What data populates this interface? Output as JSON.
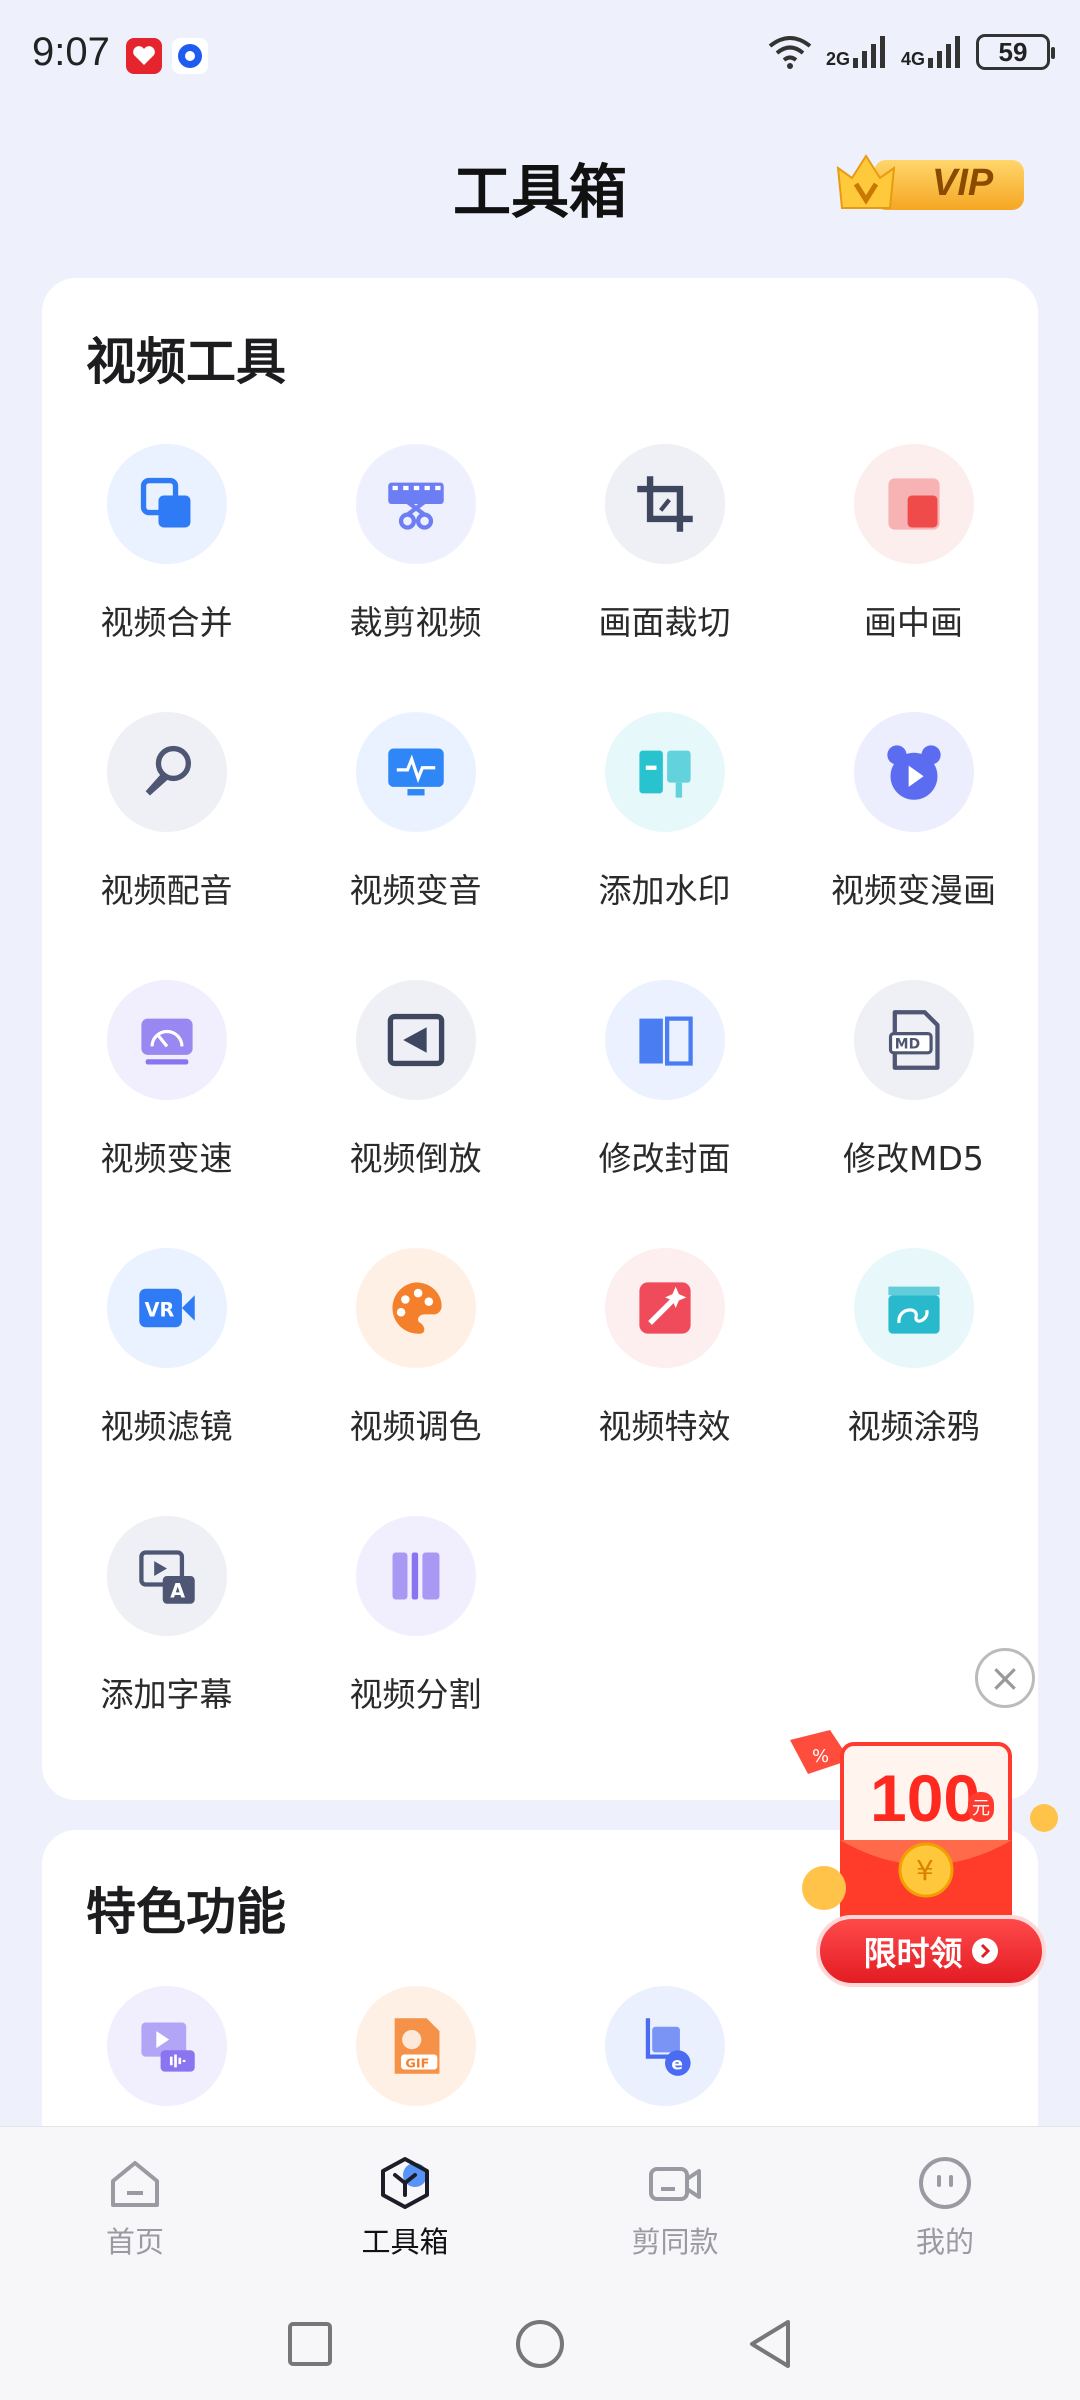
{
  "status_bar": {
    "time": "9:07",
    "network_1": "2G",
    "network_2": "4G",
    "battery": "59"
  },
  "header": {
    "title": "工具箱",
    "vip_label": "VIP"
  },
  "video_tools": {
    "title": "视频工具",
    "items": [
      {
        "label": "视频合并",
        "icon": "merge-icon",
        "color": "#2f7bf6",
        "bg": "#eaf2ff"
      },
      {
        "label": "裁剪视频",
        "icon": "film-scissors-icon",
        "color": "#6d7ef5",
        "bg": "#eef0fe"
      },
      {
        "label": "画面裁切",
        "icon": "crop-icon",
        "color": "#3f4660",
        "bg": "#eef0f5"
      },
      {
        "label": "画中画",
        "icon": "picture-in-picture-icon",
        "color": "#ef4b4b",
        "bg": "#fdeeee"
      },
      {
        "label": "视频配音",
        "icon": "microphone-icon",
        "color": "#4e5673",
        "bg": "#eef0f5"
      },
      {
        "label": "视频变音",
        "icon": "monitor-waveform-icon",
        "color": "#2f86f6",
        "bg": "#eaf2ff"
      },
      {
        "label": "添加水印",
        "icon": "stamp-icon",
        "color": "#29c2cf",
        "bg": "#e7f8fa"
      },
      {
        "label": "视频变漫画",
        "icon": "bear-play-icon",
        "color": "#5b6cf0",
        "bg": "#eceefd"
      },
      {
        "label": "视频变速",
        "icon": "speedometer-icon",
        "color": "#8a74f0",
        "bg": "#f1eefd"
      },
      {
        "label": "视频倒放",
        "icon": "reverse-play-icon",
        "color": "#3f4660",
        "bg": "#eef0f5"
      },
      {
        "label": "修改封面",
        "icon": "book-cover-icon",
        "color": "#4a7cf2",
        "bg": "#ebf1fe"
      },
      {
        "label": "修改MD5",
        "icon": "md5-file-icon",
        "color": "#4e5673",
        "bg": "#eef0f5"
      },
      {
        "label": "视频滤镜",
        "icon": "vr-camera-icon",
        "color": "#2f7bf6",
        "bg": "#eaf2ff"
      },
      {
        "label": "视频调色",
        "icon": "palette-icon",
        "color": "#f5802b",
        "bg": "#fff0e6"
      },
      {
        "label": "视频特效",
        "icon": "magic-wand-icon",
        "color": "#ef4b5a",
        "bg": "#fdeef0"
      },
      {
        "label": "视频涂鸦",
        "icon": "clapper-doodle-icon",
        "color": "#29b9cc",
        "bg": "#e7f7fa"
      },
      {
        "label": "添加字幕",
        "icon": "subtitle-icon",
        "color": "#4e5673",
        "bg": "#eef0f5"
      },
      {
        "label": "视频分割",
        "icon": "split-icon",
        "color": "#8a74f0",
        "bg": "#f1eefd"
      }
    ]
  },
  "featured": {
    "title": "特色功能",
    "items": [
      {
        "icon": "video-audio-icon",
        "color": "#8a74f0",
        "bg": "#f1eefd"
      },
      {
        "icon": "gif-icon",
        "color": "#f5802b",
        "bg": "#fff0e6"
      },
      {
        "icon": "image-edit-icon",
        "color": "#4a6cf2",
        "bg": "#ebf0fe"
      }
    ]
  },
  "promo": {
    "amount": "100",
    "unit": "元",
    "claim_label": "限时领"
  },
  "bottom_nav": {
    "items": [
      {
        "label": "首页",
        "active": false
      },
      {
        "label": "工具箱",
        "active": true
      },
      {
        "label": "剪同款",
        "active": false
      },
      {
        "label": "我的",
        "active": false
      }
    ]
  },
  "colors": {
    "accent": "#2f7bf6",
    "promo_red": "#e31c24",
    "vip_gold": "#f5a623"
  }
}
